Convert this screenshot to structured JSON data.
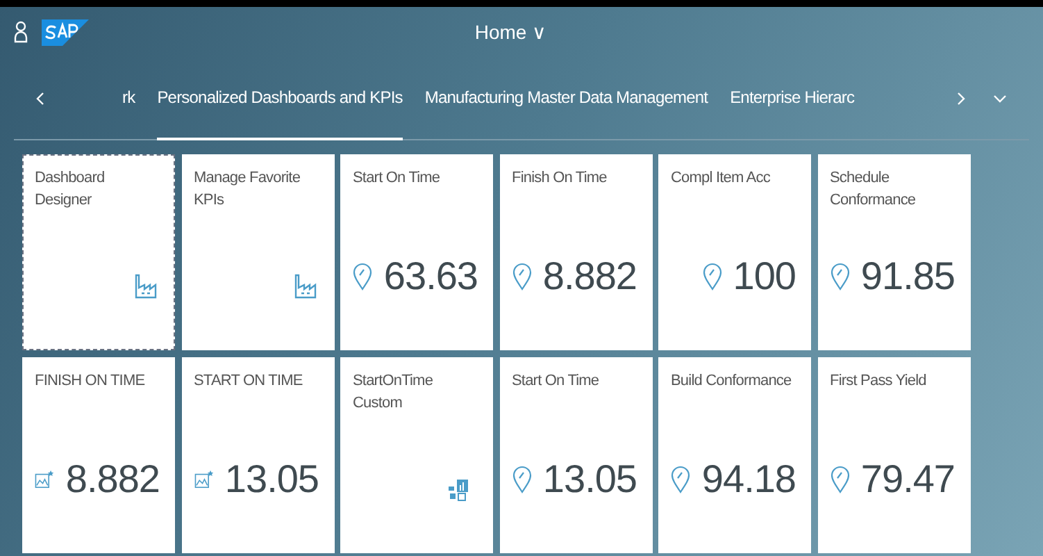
{
  "header": {
    "title": "Home ∨"
  },
  "tabs": [
    {
      "label": "rk",
      "selected": false
    },
    {
      "label": "Personalized Dashboards and KPIs",
      "selected": true
    },
    {
      "label": "Manufacturing Master Data Management",
      "selected": false
    },
    {
      "label": "Enterprise Hierarc",
      "selected": false
    }
  ],
  "tiles": [
    {
      "kind": "app",
      "title": "Dashboard Designer",
      "selected": true
    },
    {
      "kind": "app",
      "title": "Manage Favorite KPIs",
      "selected": false
    },
    {
      "kind": "kpi",
      "title": "Start On Time",
      "value": "63.63",
      "selected": false
    },
    {
      "kind": "kpi",
      "title": "Finish On Time",
      "value": "8.882",
      "selected": false
    },
    {
      "kind": "kpi",
      "title": "Compl Item Acc",
      "value": "100",
      "selected": false
    },
    {
      "kind": "kpi",
      "title": "Schedule Conformance",
      "value": "91.85",
      "selected": false
    },
    {
      "kind": "smart",
      "title": "FINISH ON TIME",
      "value": "8.882",
      "selected": false
    },
    {
      "kind": "smart",
      "title": "START ON TIME",
      "value": "13.05",
      "selected": false
    },
    {
      "kind": "custom",
      "title": "StartOnTime Custom",
      "selected": false
    },
    {
      "kind": "kpi",
      "title": "Start On Time",
      "value": "13.05",
      "selected": false
    },
    {
      "kind": "kpi",
      "title": "Build Conformance",
      "value": "94.18",
      "selected": false
    },
    {
      "kind": "kpi",
      "title": "First Pass Yield",
      "value": "79.47",
      "selected": false
    }
  ]
}
